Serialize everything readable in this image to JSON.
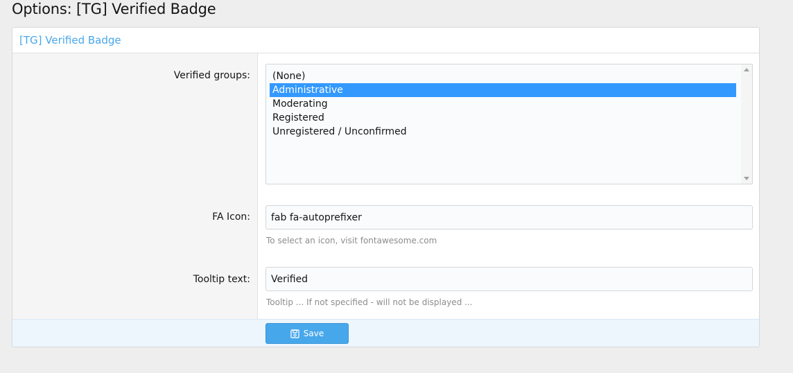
{
  "page": {
    "title": "Options: [TG] Verified Badge"
  },
  "panel": {
    "header": "[TG] Verified Badge"
  },
  "verified_groups": {
    "label": "Verified groups:",
    "options": [
      {
        "text": "(None)",
        "selected": false
      },
      {
        "text": "Administrative",
        "selected": true
      },
      {
        "text": "Moderating",
        "selected": false
      },
      {
        "text": "Registered",
        "selected": false
      },
      {
        "text": "Unregistered / Unconfirmed",
        "selected": false
      }
    ]
  },
  "fa_icon": {
    "label": "FA Icon:",
    "value": "fab fa-autoprefixer",
    "hint": "To select an icon, visit fontawesome.com"
  },
  "tooltip_text": {
    "label": "Tooltip text:",
    "value": "Verified",
    "hint": "Tooltip ... If not specified - will not be displayed ..."
  },
  "footer": {
    "save_label": "Save"
  },
  "colors": {
    "accent": "#47a7eb",
    "selection": "#3399ff"
  }
}
